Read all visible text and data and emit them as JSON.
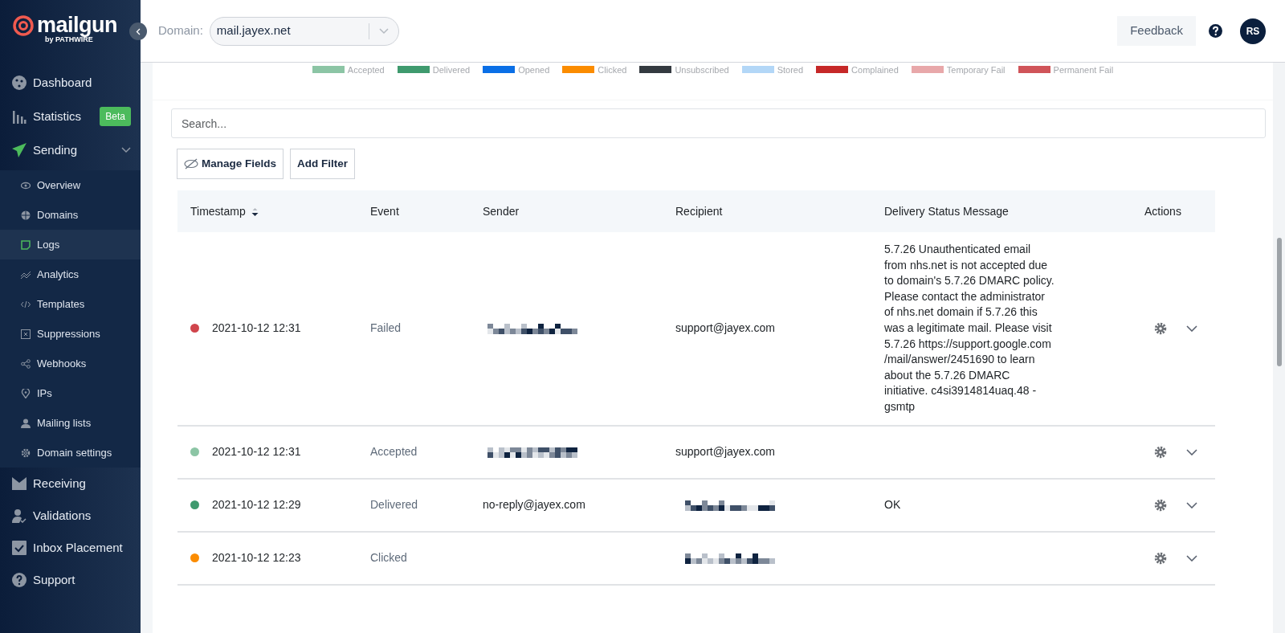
{
  "logo": {
    "name": "mailgun",
    "byline": "by PATHWIRE"
  },
  "sidebar": {
    "items": [
      {
        "label": "Dashboard",
        "selected": false
      },
      {
        "label": "Statistics",
        "selected": false,
        "badge": "Beta"
      },
      {
        "label": "Sending",
        "selected": false,
        "expanded": true,
        "children": [
          {
            "label": "Overview",
            "selected": false
          },
          {
            "label": "Domains",
            "selected": false
          },
          {
            "label": "Logs",
            "selected": true
          },
          {
            "label": "Analytics",
            "selected": false
          },
          {
            "label": "Templates",
            "selected": false
          },
          {
            "label": "Suppressions",
            "selected": false
          },
          {
            "label": "Webhooks",
            "selected": false
          },
          {
            "label": "IPs",
            "selected": false
          },
          {
            "label": "Mailing lists",
            "selected": false
          },
          {
            "label": "Domain settings",
            "selected": false
          }
        ]
      },
      {
        "label": "Receiving",
        "selected": false
      },
      {
        "label": "Validations",
        "selected": false
      },
      {
        "label": "Inbox Placement",
        "selected": false
      },
      {
        "label": "Support",
        "selected": false
      }
    ]
  },
  "header": {
    "domain_label": "Domain:",
    "domain_value": "mail.jayex.net",
    "feedback": "Feedback",
    "avatar": "RS"
  },
  "legend": [
    {
      "label": "Accepted",
      "color": "#8cc5a5"
    },
    {
      "label": "Delivered",
      "color": "#3f9a6e"
    },
    {
      "label": "Opened",
      "color": "#0a6fe6"
    },
    {
      "label": "Clicked",
      "color": "#fb8c00"
    },
    {
      "label": "Unsubscribed",
      "color": "#343a40"
    },
    {
      "label": "Stored",
      "color": "#b3d7f7"
    },
    {
      "label": "Complained",
      "color": "#c62828"
    },
    {
      "label": "Temporary Fail",
      "color": "#e8a8aa"
    },
    {
      "label": "Permanent Fail",
      "color": "#d05459"
    }
  ],
  "search": {
    "placeholder": "Search..."
  },
  "buttons": {
    "manage_fields": "Manage Fields",
    "add_filter": "Add Filter"
  },
  "table": {
    "columns": [
      "Timestamp",
      "Event",
      "Sender",
      "Recipient",
      "Delivery Status Message",
      "Actions"
    ],
    "rows": [
      {
        "color": "#d0454c",
        "timestamp": "2021-10-12 12:31",
        "event": "Failed",
        "sender_redacted": true,
        "recipient": "support@jayex.com",
        "message": "5.7.26 Unauthenticated email from nhs.net is not accepted due to domain's 5.7.26 DMARC policy. Please contact the administrator of nhs.net domain if 5.7.26 this was a legitimate mail. Please visit 5.7.26 https://support.google.com /mail/answer/2451690 to learn about the 5.7.26 DMARC initiative. c4si3914814uaq.48 - gsmtp"
      },
      {
        "color": "#8cc5a5",
        "timestamp": "2021-10-12 12:31",
        "event": "Accepted",
        "sender_redacted": true,
        "recipient": "support@jayex.com"
      },
      {
        "color": "#3f9a6e",
        "timestamp": "2021-10-12 12:29",
        "event": "Delivered",
        "sender": "no-reply@jayex.com",
        "recipient_redacted": true,
        "message": "OK"
      },
      {
        "color": "#fb8c00",
        "timestamp": "2021-10-12 12:23",
        "event": "Clicked",
        "recipient_redacted": true
      }
    ]
  }
}
